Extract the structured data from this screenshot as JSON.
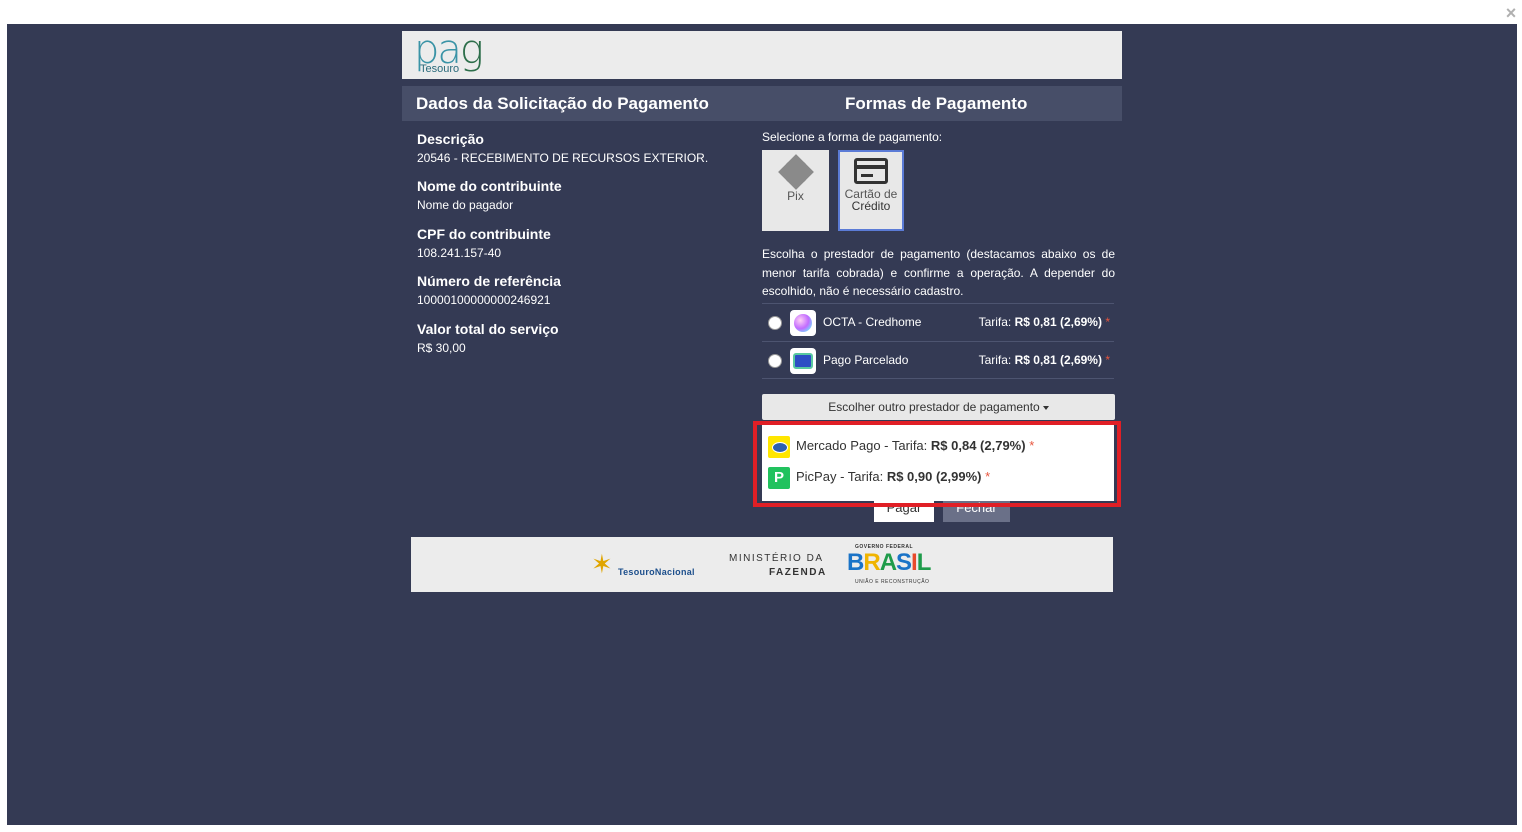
{
  "window": {
    "close_icon": "×"
  },
  "header": {
    "logo_main": "pa",
    "logo_g": "g",
    "logo_sub": "Tesouro"
  },
  "titles": {
    "left": "Dados da Solicitação do Pagamento",
    "right": "Formas de Pagamento"
  },
  "info": [
    {
      "label": "Descrição",
      "value": "20546 - RECEBIMENTO DE RECURSOS EXTERIOR."
    },
    {
      "label": "Nome do contribuinte",
      "value": "Nome do pagador"
    },
    {
      "label": "CPF do contribuinte",
      "value": "108.241.157-40"
    },
    {
      "label": "Número de referência",
      "value": "10000100000000246921"
    },
    {
      "label": "Valor total do serviço",
      "value": "R$  30,00"
    }
  ],
  "payment": {
    "select_label": "Selecione a forma de pagamento:",
    "methods": [
      {
        "label": "Pix",
        "icon": "pix-icon"
      },
      {
        "label_line1": "Cartão de",
        "label_line2": "Crédito",
        "icon": "credit-card-icon",
        "selected": true
      }
    ],
    "description": "Escolha o prestador de pagamento (destacamos abaixo os de menor tarifa cobrada) e confirme a operação. A depender do escolhido, não é necessário cadastro.",
    "providers": [
      {
        "name": "OCTA - Credhome",
        "fee_label": "Tarifa:",
        "fee_value": "R$  0,81 (2,69%)",
        "star": "*"
      },
      {
        "name": "Pago Parcelado",
        "fee_label": "Tarifa:",
        "fee_value": "R$  0,81 (2,69%)",
        "star": "*"
      }
    ],
    "other_button": "Escolher outro prestador de pagamento",
    "dropdown": [
      {
        "name": "Mercado Pago - Tarifa:",
        "fee": "R$  0,84 (2,79%)",
        "star": "*",
        "icon": "mercado-pago-icon"
      },
      {
        "name": "PicPay - Tarifa:",
        "fee": "R$  0,90 (2,99%)",
        "star": "*",
        "icon": "picpay-icon"
      }
    ],
    "pay_button": "Pagar",
    "close_button": "Fechar"
  },
  "footer": {
    "tesouro": "TesouroNacional",
    "ministerio_line1": "MINISTÉRIO DA",
    "ministerio_line2": "FAZENDA",
    "gov_top": "GOVERNO FEDERAL",
    "gov_main": [
      "B",
      "R",
      "A",
      "S",
      "I",
      "L"
    ],
    "gov_bottom": "UNIÃO E RECONSTRUÇÃO"
  },
  "colors": {
    "overlay": "#343a54",
    "titlebar": "#474e68",
    "highlight": "#e01f26",
    "accent": "#5b7bd6"
  }
}
